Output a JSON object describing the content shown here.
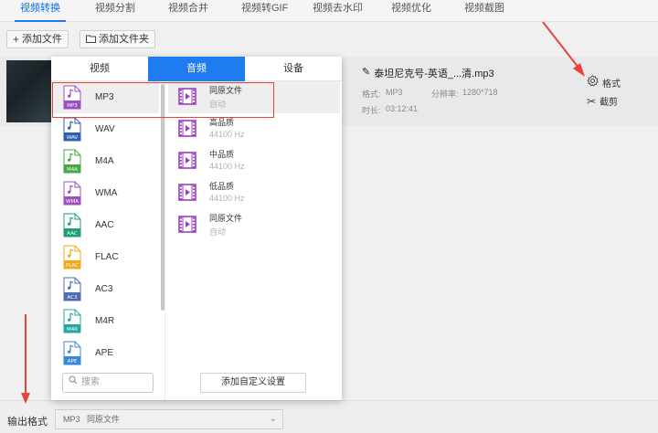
{
  "top_tabs": [
    {
      "label": "视频转换",
      "active": true
    },
    {
      "label": "视频分割"
    },
    {
      "label": "视频合并"
    },
    {
      "label": "视频转GIF"
    },
    {
      "label": "视频去水印"
    },
    {
      "label": "视频优化"
    },
    {
      "label": "视频截图"
    }
  ],
  "toolbar": {
    "add_file_label": "添加文件",
    "add_folder_label": "添加文件夹"
  },
  "file": {
    "name": "泰坦尼克号-英语_...清.mp3",
    "format_label": "格式:",
    "format_value": "MP3",
    "resolution_label": "分辨率:",
    "resolution_value": "1280*718",
    "duration_label": "时长:",
    "duration_value": "03:12:41",
    "settings_label": "格式",
    "cut_label": "截剪"
  },
  "panel": {
    "tabs": [
      "视频",
      "音频",
      "设备"
    ],
    "active_tab": "音频",
    "formats": [
      {
        "label": "MP3",
        "badge": "MP3",
        "color": "#9b4fc2",
        "selected": true
      },
      {
        "label": "WAV",
        "badge": "WAV",
        "color": "#2f5fb0"
      },
      {
        "label": "M4A",
        "badge": "M4A",
        "color": "#45a845"
      },
      {
        "label": "WMA",
        "badge": "WMA",
        "color": "#9b4fc2"
      },
      {
        "label": "AAC",
        "badge": "AAC",
        "color": "#1f9e78"
      },
      {
        "label": "FLAC",
        "badge": "FLAC",
        "color": "#f0a81c"
      },
      {
        "label": "AC3",
        "badge": "AC3",
        "color": "#4f6cb0"
      },
      {
        "label": "M4R",
        "badge": "M4R",
        "color": "#26a6a0"
      },
      {
        "label": "APE",
        "badge": "APE",
        "color": "#3a86d8"
      }
    ],
    "qualities": [
      {
        "title": "同原文件",
        "sub": "自动",
        "selected": true
      },
      {
        "title": "高品质",
        "sub": "44100 Hz"
      },
      {
        "title": "中品质",
        "sub": "44100 Hz"
      },
      {
        "title": "低品质",
        "sub": "44100 Hz"
      },
      {
        "title": "同原文件",
        "sub": "自动"
      }
    ],
    "search_placeholder": "搜索",
    "custom_button_label": "添加自定义设置"
  },
  "bottom": {
    "output_format_label": "输出格式",
    "output_format_value": "MP3   同原文件"
  },
  "colors": {
    "accent": "#1e7cf0",
    "highlight_box": "#e8423c",
    "quality_icon": "#9b3fc0"
  }
}
